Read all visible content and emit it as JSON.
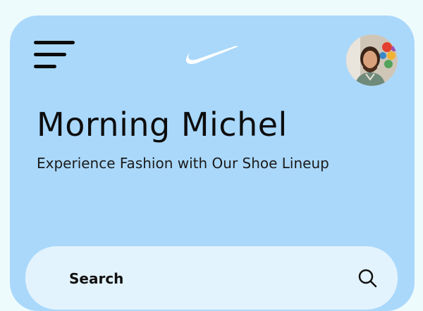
{
  "header": {
    "menu_icon": "hamburger-menu-icon",
    "logo_icon": "nike-swoosh-logo",
    "avatar_icon": "user-avatar-photo"
  },
  "hero": {
    "greeting": "Morning Michel",
    "tagline": "Experience Fashion with Our Shoe Lineup"
  },
  "search": {
    "placeholder": "Search",
    "icon": "search-icon"
  },
  "colors": {
    "page_background": "#eefbfd",
    "card_background": "#aad8fb",
    "search_background": "#e3f3fd",
    "text": "#0d0d0d"
  }
}
